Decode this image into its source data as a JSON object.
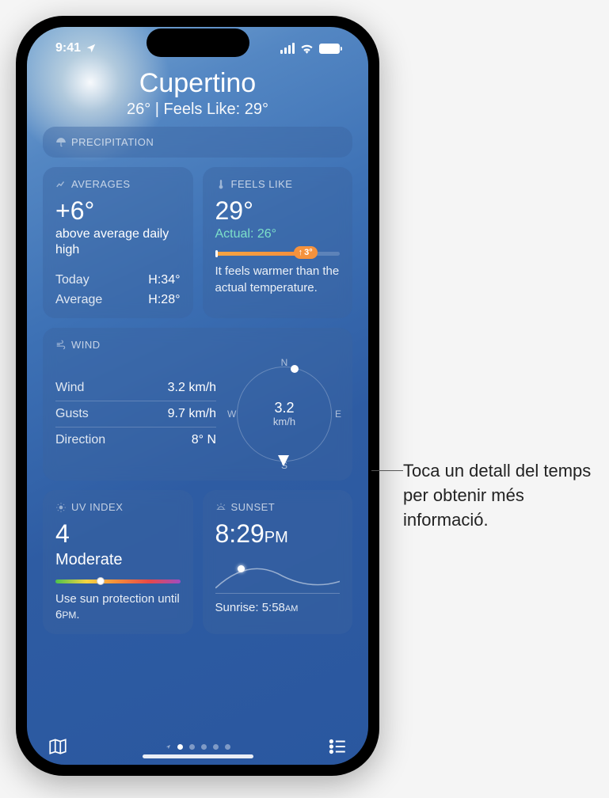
{
  "status": {
    "time": "9:41"
  },
  "header": {
    "city": "Cupertino",
    "temp": "26°",
    "divider": " | ",
    "feels_prefix": "Feels Like: ",
    "feels": "29°"
  },
  "precip": {
    "title": "PRECIPITATION"
  },
  "averages": {
    "title": "AVERAGES",
    "value": "+6°",
    "desc": "above average daily high",
    "rows": [
      {
        "label": "Today",
        "value": "H:34°"
      },
      {
        "label": "Average",
        "value": "H:28°"
      }
    ]
  },
  "feelslike": {
    "title": "FEELS LIKE",
    "value": "29°",
    "actual_label": "Actual: 26°",
    "diff": "3°",
    "desc": "It feels warmer than the actual temperature."
  },
  "wind": {
    "title": "WIND",
    "rows": [
      {
        "label": "Wind",
        "value": "3.2 km/h"
      },
      {
        "label": "Gusts",
        "value": "9.7 km/h"
      },
      {
        "label": "Direction",
        "value": "8° N"
      }
    ],
    "compass_value": "3.2",
    "compass_unit": "km/h",
    "n": "N",
    "s": "S",
    "e": "E",
    "w": "W"
  },
  "uv": {
    "title": "UV INDEX",
    "value": "4",
    "level": "Moderate",
    "desc_prefix": "Use sun protection until 6",
    "desc_suffix": "PM",
    "desc_end": "."
  },
  "sunset": {
    "title": "SUNSET",
    "time": "8:29",
    "ampm": "PM",
    "sunrise_label": "Sunrise: 5:58",
    "sunrise_ampm": "AM"
  },
  "annotation": "Toca un detall del temps per obtenir més informació."
}
